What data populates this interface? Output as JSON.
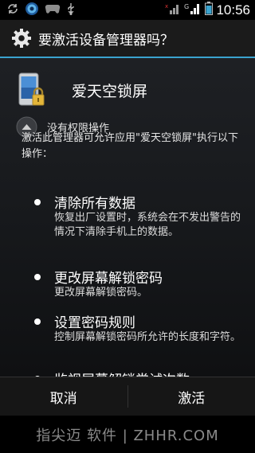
{
  "status_bar": {
    "time": "10:56",
    "icons": [
      "sync-icon",
      "browser-icon",
      "game-controller-icon",
      "usb-icon",
      "signal-icon",
      "battery-icon"
    ]
  },
  "dialog": {
    "title": "要激活设备管理器吗？",
    "title_icon": "gear-icon",
    "accent_color": "#3aa3cf"
  },
  "app": {
    "name": "爱天空锁屏",
    "icon": "phone-lock-icon"
  },
  "permission_toggle": {
    "label": "没有权限操作",
    "icon": "expand-up-icon"
  },
  "description": "激活此管理器可允许应用\"爱天空锁屏\"执行以下操作：",
  "permissions": [
    {
      "title": "清除所有数据",
      "desc": "恢复出厂设置时，系统会在不发出警告的情况下清除手机上的数据。"
    },
    {
      "title": "更改屏幕解锁密码",
      "desc": "更改屏幕解锁密码。"
    },
    {
      "title": "设置密码规则",
      "desc": "控制屏幕解锁密码所允许的长度和字符。"
    },
    {
      "title": "监视屏幕解锁尝试次数",
      "desc": ""
    }
  ],
  "buttons": {
    "cancel": "取消",
    "activate": "激活"
  },
  "watermark": "指尖迈 软件 | ZHHR.COM"
}
